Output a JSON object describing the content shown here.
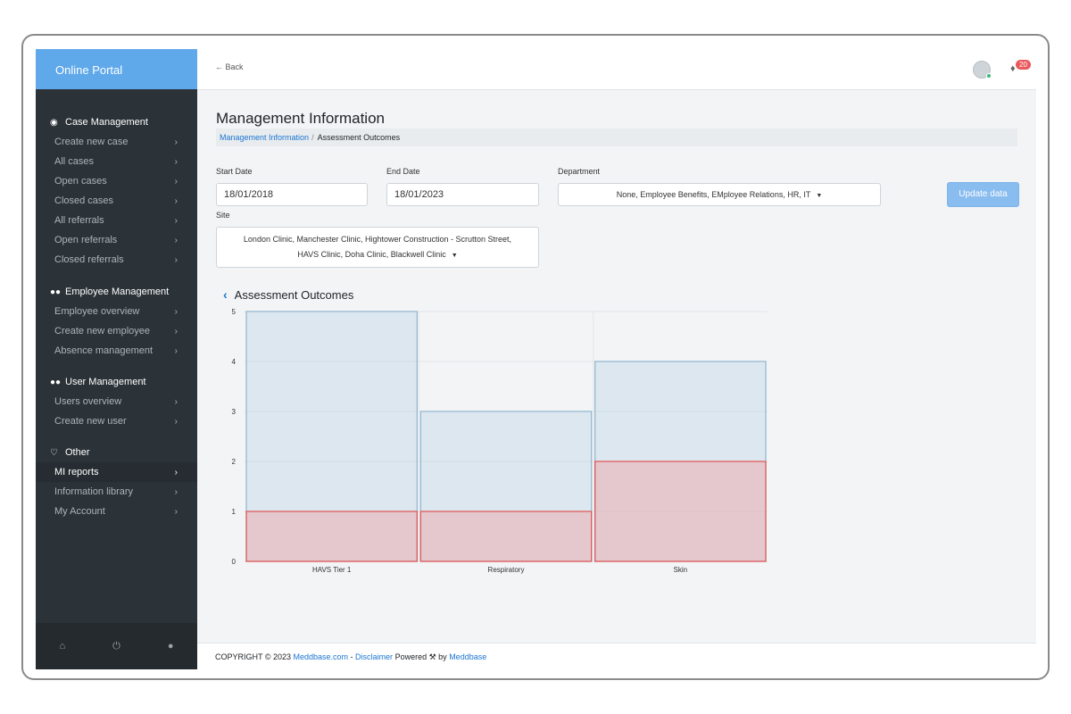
{
  "sidebar": {
    "brand": "Online Portal",
    "sections": [
      {
        "title": "Case Management",
        "icon": "target-circle-icon",
        "items": [
          "Create new case",
          "All cases",
          "Open cases",
          "Closed cases",
          "All referrals",
          "Open referrals",
          "Closed referrals"
        ]
      },
      {
        "title": "Employee Management",
        "icon": "users-icon",
        "items": [
          "Employee overview",
          "Create new employee",
          "Absence management"
        ]
      },
      {
        "title": "User Management",
        "icon": "users-icon",
        "items": [
          "Users overview",
          "Create new user"
        ]
      },
      {
        "title": "Other",
        "icon": "heart-icon",
        "items": [
          "MI reports",
          "Information library",
          "My Account"
        ]
      }
    ],
    "active_item": "MI reports",
    "footer_icons": [
      "home-icon",
      "power-icon",
      "user-icon"
    ]
  },
  "topbar": {
    "back_label": "Back",
    "notification_count": "20"
  },
  "main": {
    "title": "Management Information",
    "breadcrumb": {
      "link": "Management Information",
      "separator": "/",
      "current": "Assessment Outcomes"
    },
    "filters": {
      "start_date_label": "Start Date",
      "start_date_value": "18/01/2018",
      "end_date_label": "End Date",
      "end_date_value": "18/01/2023",
      "department_label": "Department",
      "department_value": "None,  Employee Benefits,  EMployee Relations,  HR,  IT",
      "site_label": "Site",
      "site_line1": "London Clinic,  Manchester Clinic,  Hightower Construction - Scrutton Street,",
      "site_line2": "HAVS Clinic,  Doha Clinic,  Blackwell Clinic",
      "update_button": "Update data"
    },
    "chart_heading": "Assessment Outcomes"
  },
  "chart_data": {
    "type": "bar",
    "title": "Assessment Outcomes",
    "categories": [
      "HAVS Tier 1",
      "Respiratory",
      "Skin"
    ],
    "series": [
      {
        "values": [
          5,
          3,
          4
        ],
        "color": "#8fb4cf"
      },
      {
        "values": [
          1,
          1,
          2
        ],
        "color": "#e05252"
      }
    ],
    "ylim": [
      0,
      5
    ],
    "yticks": [
      "0",
      "1",
      "2",
      "3",
      "4",
      "5"
    ],
    "grid": true
  },
  "footer": {
    "prefix": "COPYRIGHT © 2023 ",
    "site_link": "Meddbase.com",
    "dash": " - ",
    "disclaimer_link": "Disclaimer",
    "powered": " Powered ",
    "by": " by ",
    "brand_link": "Meddbase"
  }
}
